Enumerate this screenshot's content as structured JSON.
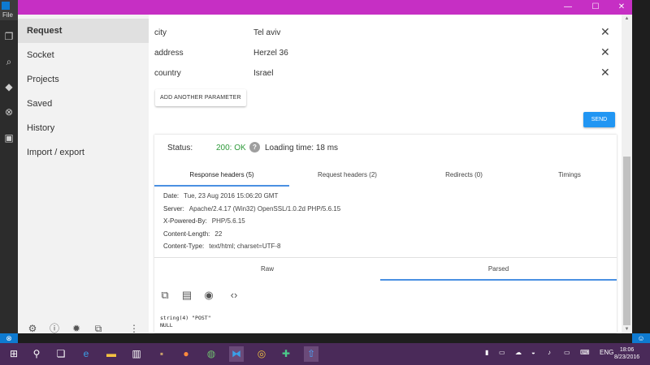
{
  "vscode": {
    "menu_file": "File",
    "status_left": "⊗",
    "status_right": "☺"
  },
  "window": {
    "minimize": "—",
    "maximize": "☐",
    "close": "✕"
  },
  "sidebar": {
    "items": [
      {
        "label": "Request",
        "active": true
      },
      {
        "label": "Socket"
      },
      {
        "label": "Projects"
      },
      {
        "label": "Saved"
      },
      {
        "label": "History"
      },
      {
        "label": "Import / export"
      }
    ]
  },
  "params": [
    {
      "key": "city",
      "value": "Tel aviv"
    },
    {
      "key": "address",
      "value": "Herzel 36"
    },
    {
      "key": "country",
      "value": "Israel"
    }
  ],
  "add_param_label": "ADD ANOTHER PARAMETER",
  "send_label": "SEND",
  "response": {
    "status_label": "Status:",
    "status_value": "200: OK",
    "help_glyph": "?",
    "loading_time": "Loading time: 18 ms",
    "tabs": [
      "Response headers (5)",
      "Request headers (2)",
      "Redirects (0)",
      "Timings"
    ],
    "headers": [
      {
        "name": "Date:",
        "value": "Tue, 23 Aug 2016 15:06:20 GMT"
      },
      {
        "name": "Server:",
        "value": "Apache/2.4.17 (Win32) OpenSSL/1.0.2d PHP/5.6.15"
      },
      {
        "name": "X-Powered-By:",
        "value": "PHP/5.6.15"
      },
      {
        "name": "Content-Length:",
        "value": "22"
      },
      {
        "name": "Content-Type:",
        "value": "text/html; charset=UTF-8"
      }
    ],
    "body_tabs": [
      "Raw",
      "Parsed"
    ],
    "output": "string(4) \"POST\"\nNULL"
  },
  "taskbar": {
    "language": "ENG",
    "time": "18:06",
    "date": "8/23/2016"
  }
}
